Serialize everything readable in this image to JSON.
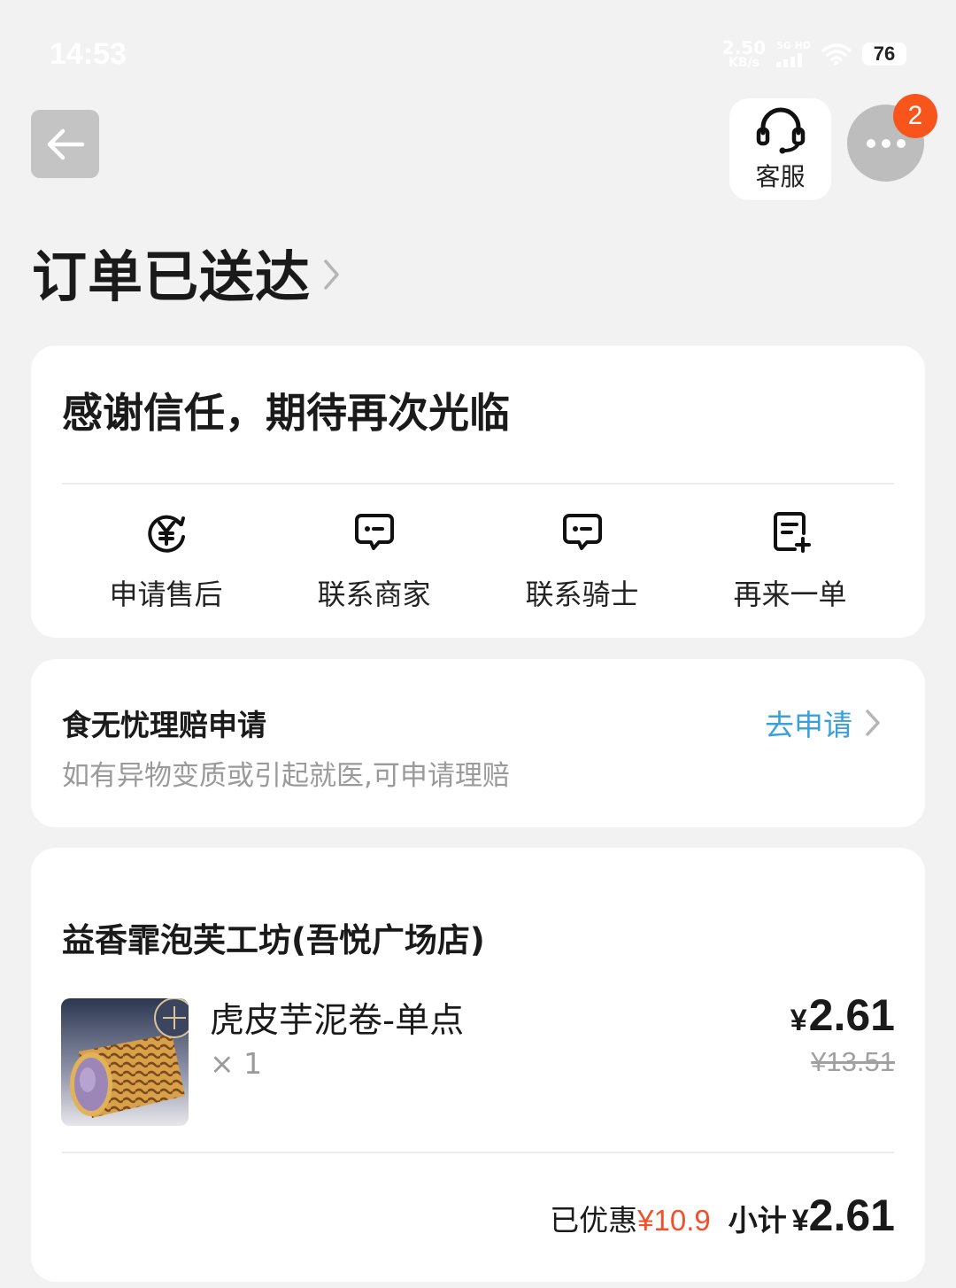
{
  "status_bar": {
    "time": "14:53",
    "net_speed_value": "2.50",
    "net_speed_unit": "KB/s",
    "signal_label": "5G HD",
    "battery": "76"
  },
  "header": {
    "service_label": "客服",
    "notification_count": "2"
  },
  "page_title": "订单已送达",
  "thanks_card": {
    "message": "感谢信任，期待再次光临",
    "actions": [
      {
        "label": "申请售后",
        "icon": "refund-yen-icon"
      },
      {
        "label": "联系商家",
        "icon": "chat-bubble-icon"
      },
      {
        "label": "联系骑士",
        "icon": "chat-bubble-icon"
      },
      {
        "label": "再来一单",
        "icon": "reorder-document-icon"
      }
    ]
  },
  "claim_card": {
    "title": "食无忧理赔申请",
    "subtitle": "如有异物变质或引起就医,可申请理赔",
    "link_label": "去申请"
  },
  "order_card": {
    "shop_name": "益香霏泡芙工坊(吾悦广场店)",
    "items": [
      {
        "name": "虎皮芋泥卷-单点",
        "quantity": "× 1",
        "price_currency": "¥",
        "price": "2.61",
        "original_price": "¥13.51"
      }
    ],
    "discount_label": "已优惠",
    "discount_amount": "¥10.9",
    "subtotal_label": "小计",
    "subtotal_currency": "¥",
    "subtotal_amount": "2.61"
  },
  "colors": {
    "background": "#f2f2f2",
    "accent_link": "#3aa0d8",
    "discount_red": "#f0502a",
    "badge_orange": "#f8551c"
  }
}
